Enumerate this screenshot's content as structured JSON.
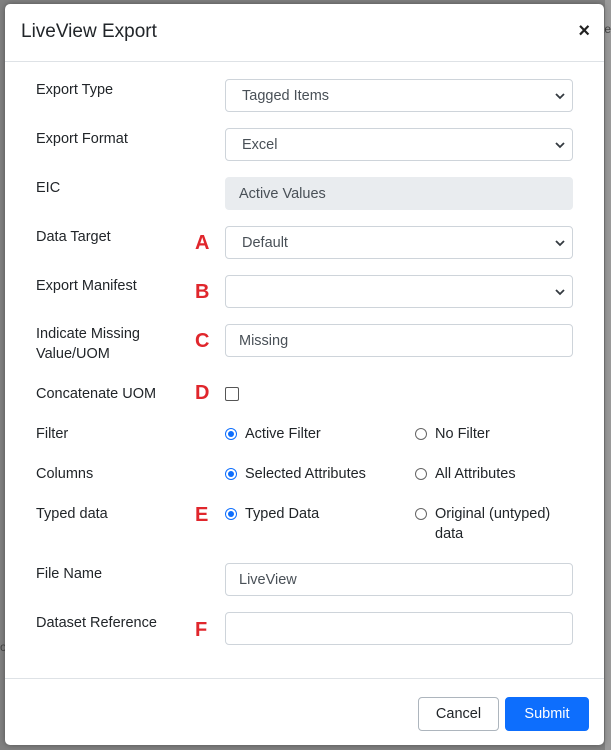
{
  "background": {
    "right_text": "te",
    "left_text": "ot"
  },
  "modal": {
    "title": "LiveView Export",
    "close_icon": "×"
  },
  "form": {
    "export_type": {
      "label": "Export Type",
      "value": "Tagged Items"
    },
    "export_format": {
      "label": "Export Format",
      "value": "Excel"
    },
    "eic": {
      "label": "EIC",
      "value": "Active Values"
    },
    "data_target": {
      "label": "Data Target",
      "marker": "A",
      "value": "Default"
    },
    "export_manifest": {
      "label": "Export Manifest",
      "marker": "B",
      "value": ""
    },
    "missing": {
      "label_line1": "Indicate Missing",
      "label_line2": "Value/UOM",
      "marker": "C",
      "value": "Missing"
    },
    "concatenate_uom": {
      "label": "Concatenate UOM",
      "marker": "D",
      "checked": false
    },
    "filter": {
      "label": "Filter",
      "options": [
        "Active Filter",
        "No Filter"
      ],
      "selected": "Active Filter"
    },
    "columns": {
      "label": "Columns",
      "options": [
        "Selected Attributes",
        "All Attributes"
      ],
      "selected": "Selected Attributes"
    },
    "typed_data": {
      "label": "Typed data",
      "marker": "E",
      "option1": "Typed Data",
      "option2_line1": "Original (untyped)",
      "option2_line2": "data",
      "selected": "Typed Data"
    },
    "file_name": {
      "label": "File Name",
      "value": "LiveView"
    },
    "dataset_reference": {
      "label": "Dataset Reference",
      "marker": "F",
      "value": ""
    }
  },
  "footer": {
    "cancel_label": "Cancel",
    "submit_label": "Submit"
  },
  "colors": {
    "primary": "#0d6efd",
    "marker": "#e0262c"
  }
}
